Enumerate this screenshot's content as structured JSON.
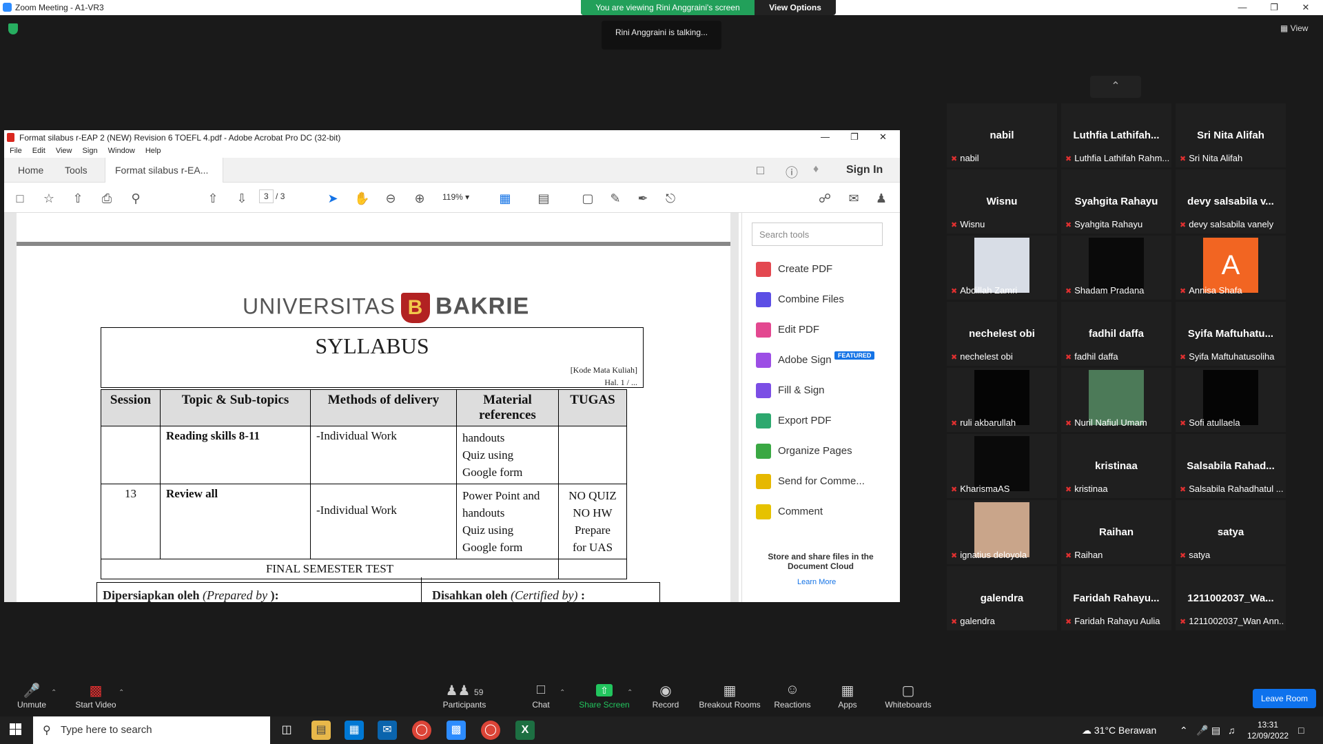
{
  "window": {
    "title": "Zoom Meeting - A1-VR3"
  },
  "share_banner": {
    "viewing": "You are viewing Rini Anggraini's screen",
    "options": "View Options"
  },
  "talking": "Rini Anggraini is talking...",
  "view_btn": "View",
  "acrobat": {
    "title": "Format silabus r-EAP 2 (NEW) Revision 6 TOEFL 4.pdf - Adobe Acrobat Pro DC (32-bit)",
    "menu": [
      "File",
      "Edit",
      "View",
      "Sign",
      "Window",
      "Help"
    ],
    "tabs": {
      "home": "Home",
      "tools": "Tools",
      "doc": "Format silabus r-EA..."
    },
    "sign_in": "Sign In",
    "page_current": "3",
    "page_total": "/ 3",
    "zoom": "119%",
    "search_placeholder": "Search tools",
    "right_tools": [
      "Create PDF",
      "Combine Files",
      "Edit PDF",
      "Adobe Sign",
      "Fill & Sign",
      "Export PDF",
      "Organize Pages",
      "Send for Comme...",
      "Comment"
    ],
    "featured": "FEATURED",
    "cloud_text": "Store and share files in the Document Cloud",
    "learn_more": "Learn More"
  },
  "doc": {
    "logo_left": "UNIVERSITAS",
    "logo_right": "BAKRIE",
    "heading": "SYLLABUS",
    "kode": "[Kode Mata Kuliah]",
    "hal": "Hal. 1 / ...",
    "headers": [
      "Session",
      "Topic & Sub-topics",
      "Methods of delivery",
      "Material references",
      "TUGAS"
    ],
    "row1": {
      "session": "",
      "topic": "Reading skills 8-11",
      "method": "-Individual Work",
      "material": [
        "handouts",
        "Quiz using",
        "Google form"
      ],
      "tugas": []
    },
    "row2": {
      "session": "13",
      "topic": "Review all",
      "method": "-Individual Work",
      "material": [
        "Power Point and",
        "handouts",
        "Quiz using",
        "Google form"
      ],
      "tugas": [
        "NO QUIZ",
        "NO HW",
        "Prepare",
        "for UAS"
      ]
    },
    "final": "FINAL SEMESTER TEST",
    "prepared_a": "Dipersiapkan oleh ",
    "prepared_b": "(Prepared by ",
    "prepared_c": "):",
    "certified_a": "Disahkan oleh ",
    "certified_b": "(Certified by)",
    "certified_c": " :"
  },
  "participants": [
    {
      "name": "nabil",
      "label": "nabil"
    },
    {
      "name": "Luthfia  Lathifah...",
      "label": "Luthfia Lathifah Rahm..."
    },
    {
      "name": "Sri Nita Alifah",
      "label": "Sri Nita Alifah"
    },
    {
      "name": "Wisnu",
      "label": "Wisnu"
    },
    {
      "name": "Syahgita Rahayu",
      "label": "Syahgita Rahayu"
    },
    {
      "name": "devy  salsabila  v...",
      "label": "devy salsabila vanely"
    },
    {
      "name": "",
      "label": "Abdillah Zamri",
      "video": "#d8dde6"
    },
    {
      "name": "",
      "label": "Shadam Pradana",
      "video": "#0a0a0a"
    },
    {
      "name": "A",
      "label": "Annisa Shafa",
      "video": "#f26522"
    },
    {
      "name": "nechelest obi",
      "label": "nechelest obi"
    },
    {
      "name": "fadhil daffa",
      "label": "fadhil daffa"
    },
    {
      "name": "Syifa  Maftuhatu...",
      "label": "Syifa Maftuhatusoliha"
    },
    {
      "name": "",
      "label": "ruli akbarullah",
      "video": "#050505"
    },
    {
      "name": "",
      "label": "Nuril Nafiul Umam",
      "video": "#4c7a58"
    },
    {
      "name": "",
      "label": "Sofi atullaela",
      "video": "#050505"
    },
    {
      "name": "",
      "label": "KharismaAS",
      "video": "#0a0a0a"
    },
    {
      "name": "kristinaa",
      "label": "kristinaa"
    },
    {
      "name": "Salsabila  Rahad...",
      "label": "Salsabila Rahadhatul ..."
    },
    {
      "name": "",
      "label": "ignatius deloyola",
      "video": "#c9a58a"
    },
    {
      "name": "Raihan",
      "label": "Raihan"
    },
    {
      "name": "satya",
      "label": "satya"
    },
    {
      "name": "galendra",
      "label": "galendra"
    },
    {
      "name": "Faridah  Rahayu...",
      "label": "Faridah Rahayu Aulia"
    },
    {
      "name": "1211002037_Wa...",
      "label": "1211002037_Wan Ann..."
    }
  ],
  "controls": {
    "unmute": "Unmute",
    "start_video": "Start Video",
    "participants": "Participants",
    "participants_count": "59",
    "chat": "Chat",
    "share": "Share Screen",
    "record": "Record",
    "breakout": "Breakout Rooms",
    "reactions": "Reactions",
    "apps": "Apps",
    "whiteboards": "Whiteboards",
    "leave": "Leave Room"
  },
  "taskbar": {
    "search": "Type here to search",
    "weather": "31°C  Berawan",
    "time": "13:31",
    "date": "12/09/2022"
  }
}
